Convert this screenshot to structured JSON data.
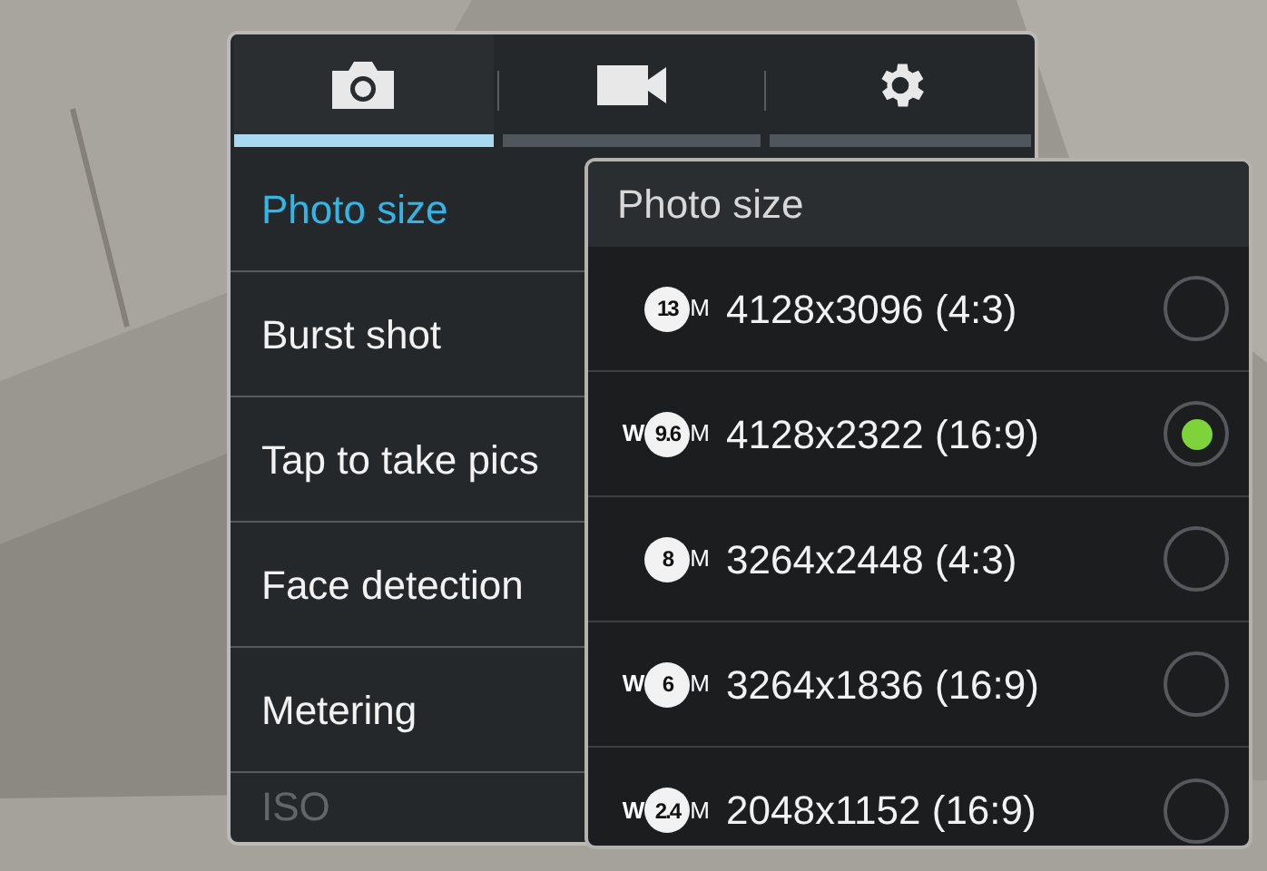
{
  "tabs": [
    {
      "kind": "camera",
      "selected": true
    },
    {
      "kind": "video",
      "selected": false
    },
    {
      "kind": "settings",
      "selected": false
    }
  ],
  "menu": [
    {
      "label": "Photo size",
      "selected": true,
      "disabled": false
    },
    {
      "label": "Burst shot",
      "selected": false,
      "disabled": false
    },
    {
      "label": "Tap to take pics",
      "selected": false,
      "disabled": false
    },
    {
      "label": "Face detection",
      "selected": false,
      "disabled": false
    },
    {
      "label": "Metering",
      "selected": false,
      "disabled": false
    },
    {
      "label": "ISO",
      "selected": false,
      "disabled": true
    }
  ],
  "popup": {
    "title": "Photo size",
    "options": [
      {
        "megapixels": "13",
        "unit": "M",
        "label": "4128x3096 (4:3)",
        "selected": false
      },
      {
        "wide": "W",
        "megapixels": "9.6",
        "unit": "M",
        "label": "4128x2322 (16:9)",
        "selected": true
      },
      {
        "megapixels": "8",
        "unit": "M",
        "label": "3264x2448 (4:3)",
        "selected": false
      },
      {
        "wide": "W",
        "megapixels": "6",
        "unit": "M",
        "label": "3264x1836 (16:9)",
        "selected": false
      },
      {
        "wide": "W",
        "megapixels": "2.4",
        "unit": "M",
        "label": "2048x1152 (16:9)",
        "selected": false
      }
    ]
  }
}
